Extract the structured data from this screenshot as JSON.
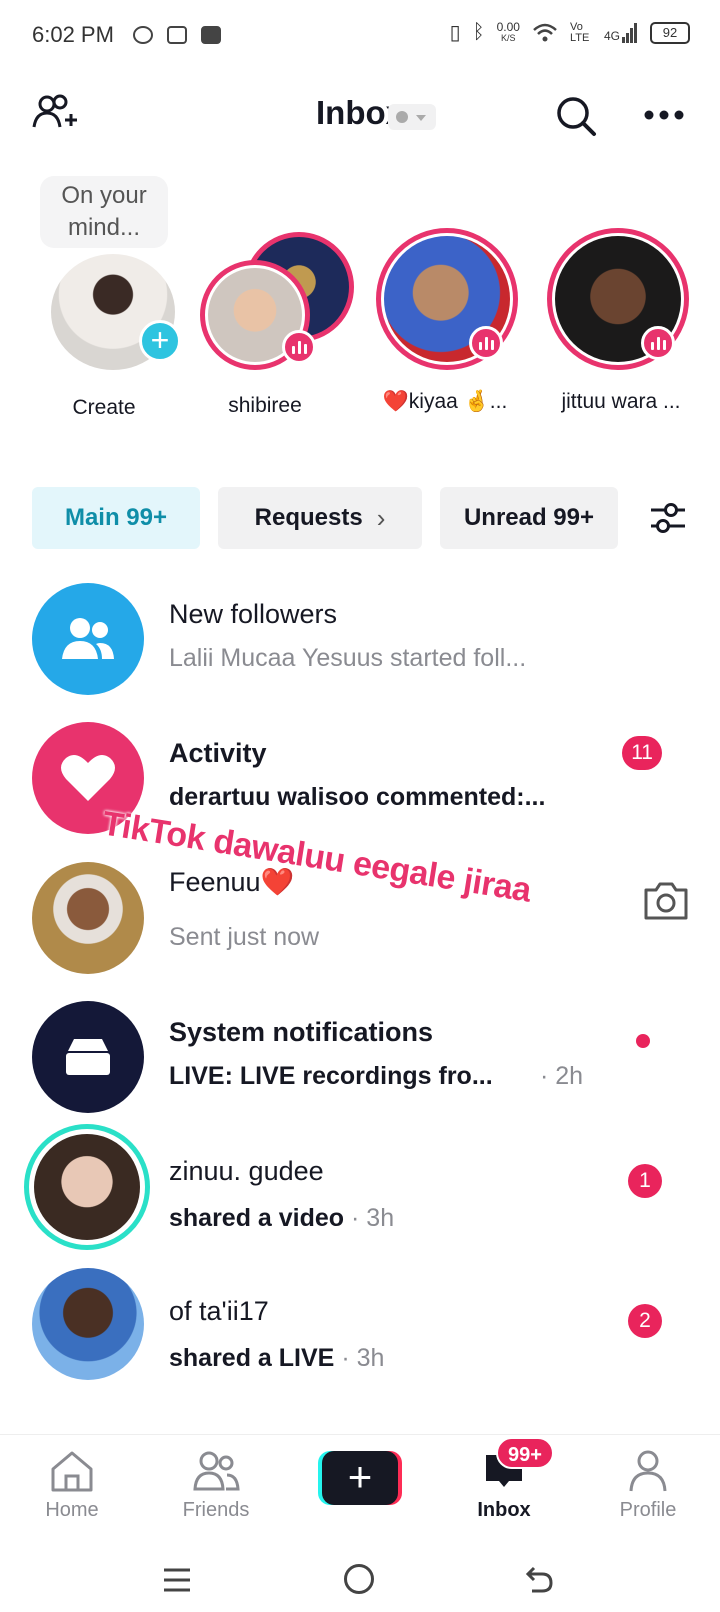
{
  "status_bar": {
    "time": "6:02 PM",
    "net_speed": "0.00",
    "net_unit": "K/S",
    "volte": "Vo LTE",
    "network": "4G",
    "battery": "92"
  },
  "header": {
    "title": "Inbox",
    "add_friends_icon": "add-person-icon",
    "search_icon": "search-icon",
    "more_icon": "more-icon"
  },
  "stories": {
    "bubble": "On your mind...",
    "items": [
      {
        "label": "Create"
      },
      {
        "label": "shibiree"
      },
      {
        "label": "❤️kiyaa 🤞..."
      },
      {
        "label": "jittuu wara ..."
      }
    ]
  },
  "tabs": [
    {
      "label": "Main 99+"
    },
    {
      "label": "Requests"
    },
    {
      "label": "Unread 99+"
    }
  ],
  "messages": [
    {
      "name": "New followers",
      "preview": "Lalii Mucaa Yesuus started foll..."
    },
    {
      "name": "Activity",
      "preview": "derartuu walisoo commented:...",
      "badge": "11"
    },
    {
      "name": "Feenuu❤️",
      "preview": "Sent just now"
    },
    {
      "name": "System notifications",
      "preview": "LIVE: LIVE recordings fro...",
      "time": "· 2h"
    },
    {
      "name": "zinuu. gudee",
      "preview": "shared a video",
      "time": "· 3h",
      "badge": "1"
    },
    {
      "name": "of ta'ii17",
      "preview": "shared a LIVE",
      "time": "· 3h",
      "badge": "2"
    }
  ],
  "overlay_text": "TikTok dawaluu eegale jiraa",
  "bottom_nav": {
    "home": "Home",
    "friends": "Friends",
    "inbox": "Inbox",
    "inbox_badge": "99+",
    "profile": "Profile"
  },
  "colors": {
    "accent": "#e8336d",
    "badge": "#e9245c",
    "followers_blue": "#25a8e8",
    "tab_active_bg": "#e3f6fb",
    "tab_active_text": "#0f8ea8",
    "system_dark": "#141838"
  }
}
